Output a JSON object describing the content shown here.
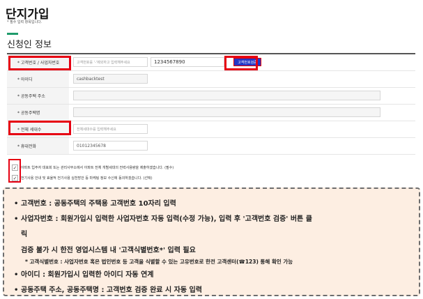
{
  "page": {
    "title": "단지가입",
    "subtitle": "* 필수 입력 항목입니다.",
    "section_title": "신청인 정보"
  },
  "form": {
    "customer_number": {
      "label": "* 고객번호 / 사업자번호",
      "placeholder": "고객번호를 '-'제외하고 입력해주세요",
      "value": "1234567890",
      "verify_button": "고객번호검증"
    },
    "user_id": {
      "label": "* 아이디",
      "value": "cashbacktest"
    },
    "complex_address": {
      "label": "* 공동주택 주소",
      "value": ""
    },
    "complex_name": {
      "label": "* 공동주택명",
      "value": ""
    },
    "households": {
      "label": "* 전체 세대수",
      "placeholder": "전체세대수를 입력해주세요"
    },
    "mobile": {
      "label": "* 휴대전화",
      "value": "01012345678"
    }
  },
  "agreements": [
    {
      "text": "아파트 입주자 대표회 또는 관리사무소에서 아파트 전체 개별세대의 전력사용량을 제출하겠습니다. (필수)",
      "check": "✓"
    },
    {
      "text": "전기사용 안내 및 효율적 전기사용 실천방안 등 마케팅 정보 수신에 동의하겠습니다. (선택)",
      "check": "✓"
    }
  ],
  "notes": {
    "bullet": "•",
    "line1": "고객번호 : 공동주택의 주택용 고객번호 10자리 입력",
    "line2": "사업자번호 : 회원가입시 입력한 사업자번호 자동 입력(수정 가능), 입력 후 '고객번호 검증' 버튼 클",
    "line2b": "릭",
    "line3": "검증 불가 시 한전 영업시스템 내 '고객식별번호*' 입력 필요",
    "line4": "* 고객식별번호 : 사업자번호 혹은 법인번호 등 고객을 식별할 수 있는 고유번호로 한전 고객센터(☎123) 통해 확인 가능",
    "line5": "아이디 : 회원가입시 입력한 아이디 자동 연계",
    "line6": "공동주택 주소, 공동주택명 : 고객번호 검증 완료 시 자동 입력"
  }
}
